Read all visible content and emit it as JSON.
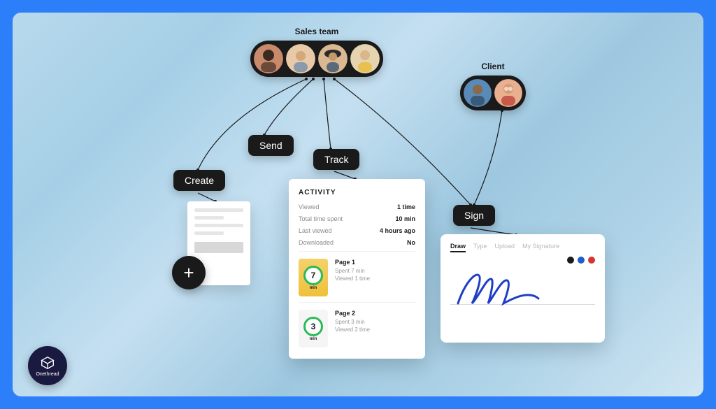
{
  "groups": {
    "sales": {
      "label": "Sales team"
    },
    "client": {
      "label": "Client"
    }
  },
  "actions": {
    "create": "Create",
    "send": "Send",
    "track": "Track",
    "sign": "Sign"
  },
  "activity": {
    "title": "ACTIVITY",
    "stats": [
      {
        "label": "Viewed",
        "value": "1 time"
      },
      {
        "label": "Total time spent",
        "value": "10 min"
      },
      {
        "label": "Last viewed",
        "value": "4 hours ago"
      },
      {
        "label": "Downloaded",
        "value": "No"
      }
    ],
    "pages": [
      {
        "ring": "7",
        "ring_unit": "min",
        "name": "Page 1",
        "spent": "Spent 7 min",
        "viewed": "Viewed 1 time"
      },
      {
        "ring": "3",
        "ring_unit": "min",
        "name": "Page 2",
        "spent": "Spent 3 min",
        "viewed": "Viewed 2 time"
      }
    ]
  },
  "signature": {
    "tabs": [
      "Draw",
      "Type",
      "Upload",
      "My Signature"
    ],
    "active_tab": 0
  },
  "logo": {
    "text": "Onethread"
  }
}
